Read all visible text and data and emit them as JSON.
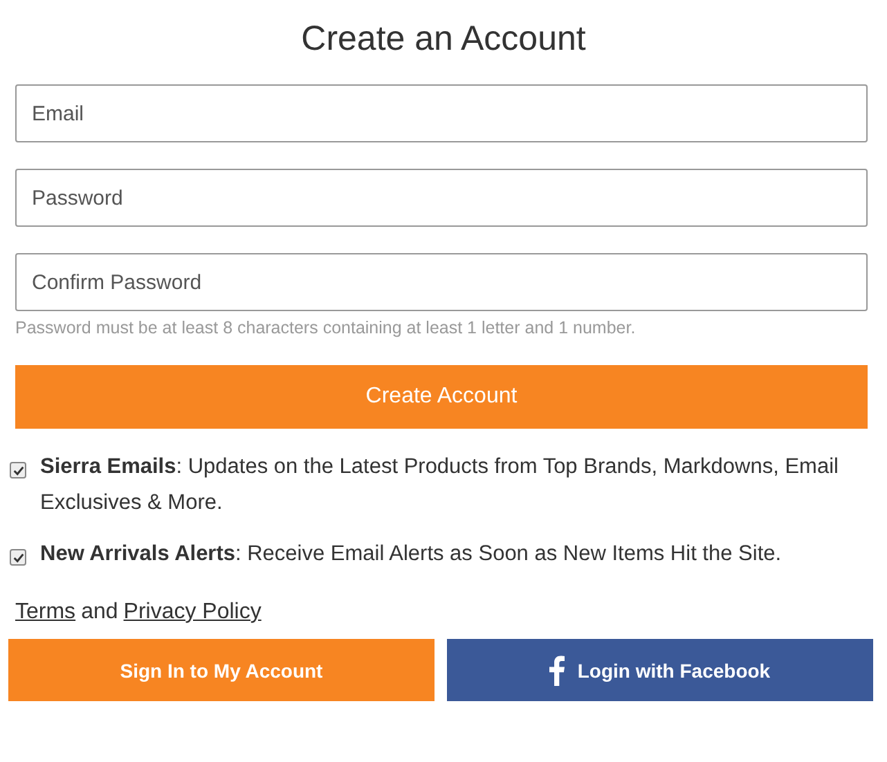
{
  "title": "Create an Account",
  "fields": [
    {
      "placeholder": "Email"
    },
    {
      "placeholder": "Password"
    },
    {
      "placeholder": "Confirm Password"
    }
  ],
  "hint": "Password must be at least 8 characters containing at least 1 letter and 1 number.",
  "submit": "Create Account",
  "options": [
    {
      "text": "**Sierra Emails**: Updates on the Latest Products from Top Brands, Markdowns, Email Exclusives & More.",
      "checked": true
    },
    {
      "text": "**New Arrivals Alerts**: Receive Email Alerts as Soon as New Items Hit the Site.",
      "checked": true
    }
  ],
  "legal": [
    {
      "kind": "link",
      "text": "Terms"
    },
    {
      "kind": "text",
      "text": "and"
    },
    {
      "kind": "link",
      "text": "Privacy Policy"
    }
  ],
  "actions": [
    {
      "kind": "signin",
      "label": "Sign In to My Account"
    },
    {
      "kind": "facebook",
      "label": "Login with Facebook"
    }
  ]
}
